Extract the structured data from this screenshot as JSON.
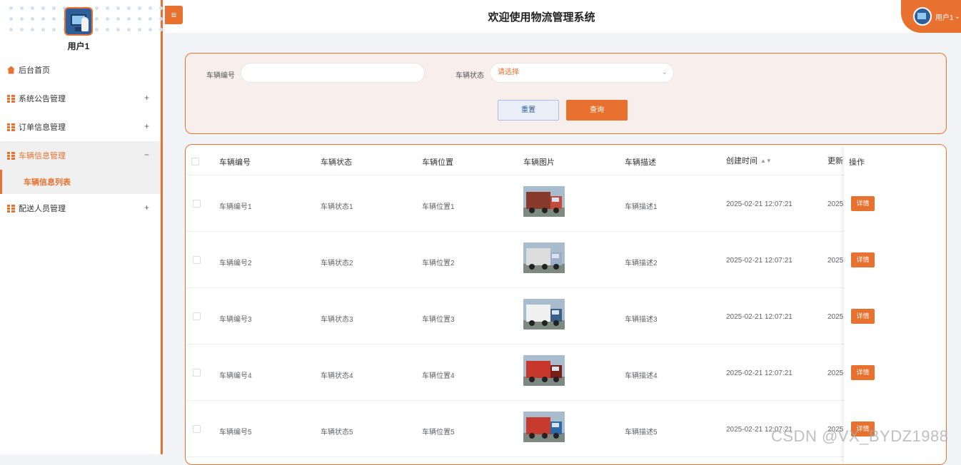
{
  "sidebar": {
    "user_name": "用户1",
    "items": [
      {
        "label": "后台首页",
        "icon": "home-icon",
        "toggle": ""
      },
      {
        "label": "系统公告管理",
        "icon": "grid-icon",
        "toggle": "+"
      },
      {
        "label": "订单信息管理",
        "icon": "grid-icon",
        "toggle": "+"
      },
      {
        "label": "车辆信息管理",
        "icon": "grid-icon",
        "toggle": "−",
        "active": true
      },
      {
        "label": "配送人员管理",
        "icon": "grid-icon",
        "toggle": "+"
      }
    ],
    "submenu": {
      "label": "车辆信息列表"
    }
  },
  "header": {
    "menu_toggle": "≡",
    "title": "欢迎使用物流管理系统",
    "user_label": "用户1",
    "user_caret": "⌄"
  },
  "search": {
    "vehicle_no_label": "车辆编号",
    "vehicle_no_value": "",
    "status_label": "车辆状态",
    "status_placeholder": "请选择",
    "reset_label": "重置",
    "query_label": "查询"
  },
  "table": {
    "columns": [
      "车辆编号",
      "车辆状态",
      "车辆位置",
      "车辆图片",
      "车辆描述",
      "创建时间",
      "更新",
      "操作"
    ],
    "rows": [
      {
        "no": "车辆编号1",
        "status": "车辆状态1",
        "location": "车辆位置1",
        "desc": "车辆描述1",
        "created": "2025-02-21 12:07:21",
        "updated": "2025",
        "action": "详情"
      },
      {
        "no": "车辆编号2",
        "status": "车辆状态2",
        "location": "车辆位置2",
        "desc": "车辆描述2",
        "created": "2025-02-21 12:07:21",
        "updated": "2025",
        "action": "详情"
      },
      {
        "no": "车辆编号3",
        "status": "车辆状态3",
        "location": "车辆位置3",
        "desc": "车辆描述3",
        "created": "2025-02-21 12:07:21",
        "updated": "2025",
        "action": "详情"
      },
      {
        "no": "车辆编号4",
        "status": "车辆状态4",
        "location": "车辆位置4",
        "desc": "车辆描述4",
        "created": "2025-02-21 12:07:21",
        "updated": "2025",
        "action": "详情"
      },
      {
        "no": "车辆编号5",
        "status": "车辆状态5",
        "location": "车辆位置5",
        "desc": "车辆描述5",
        "created": "2025-02-21 12:07:21",
        "updated": "2025",
        "action": "详情"
      }
    ]
  },
  "watermark": "CSDN @VX_BYDZ1988",
  "colors": {
    "accent": "#e8712f",
    "panel_bg": "#f8efec",
    "page_bg": "#f3f4f8"
  }
}
